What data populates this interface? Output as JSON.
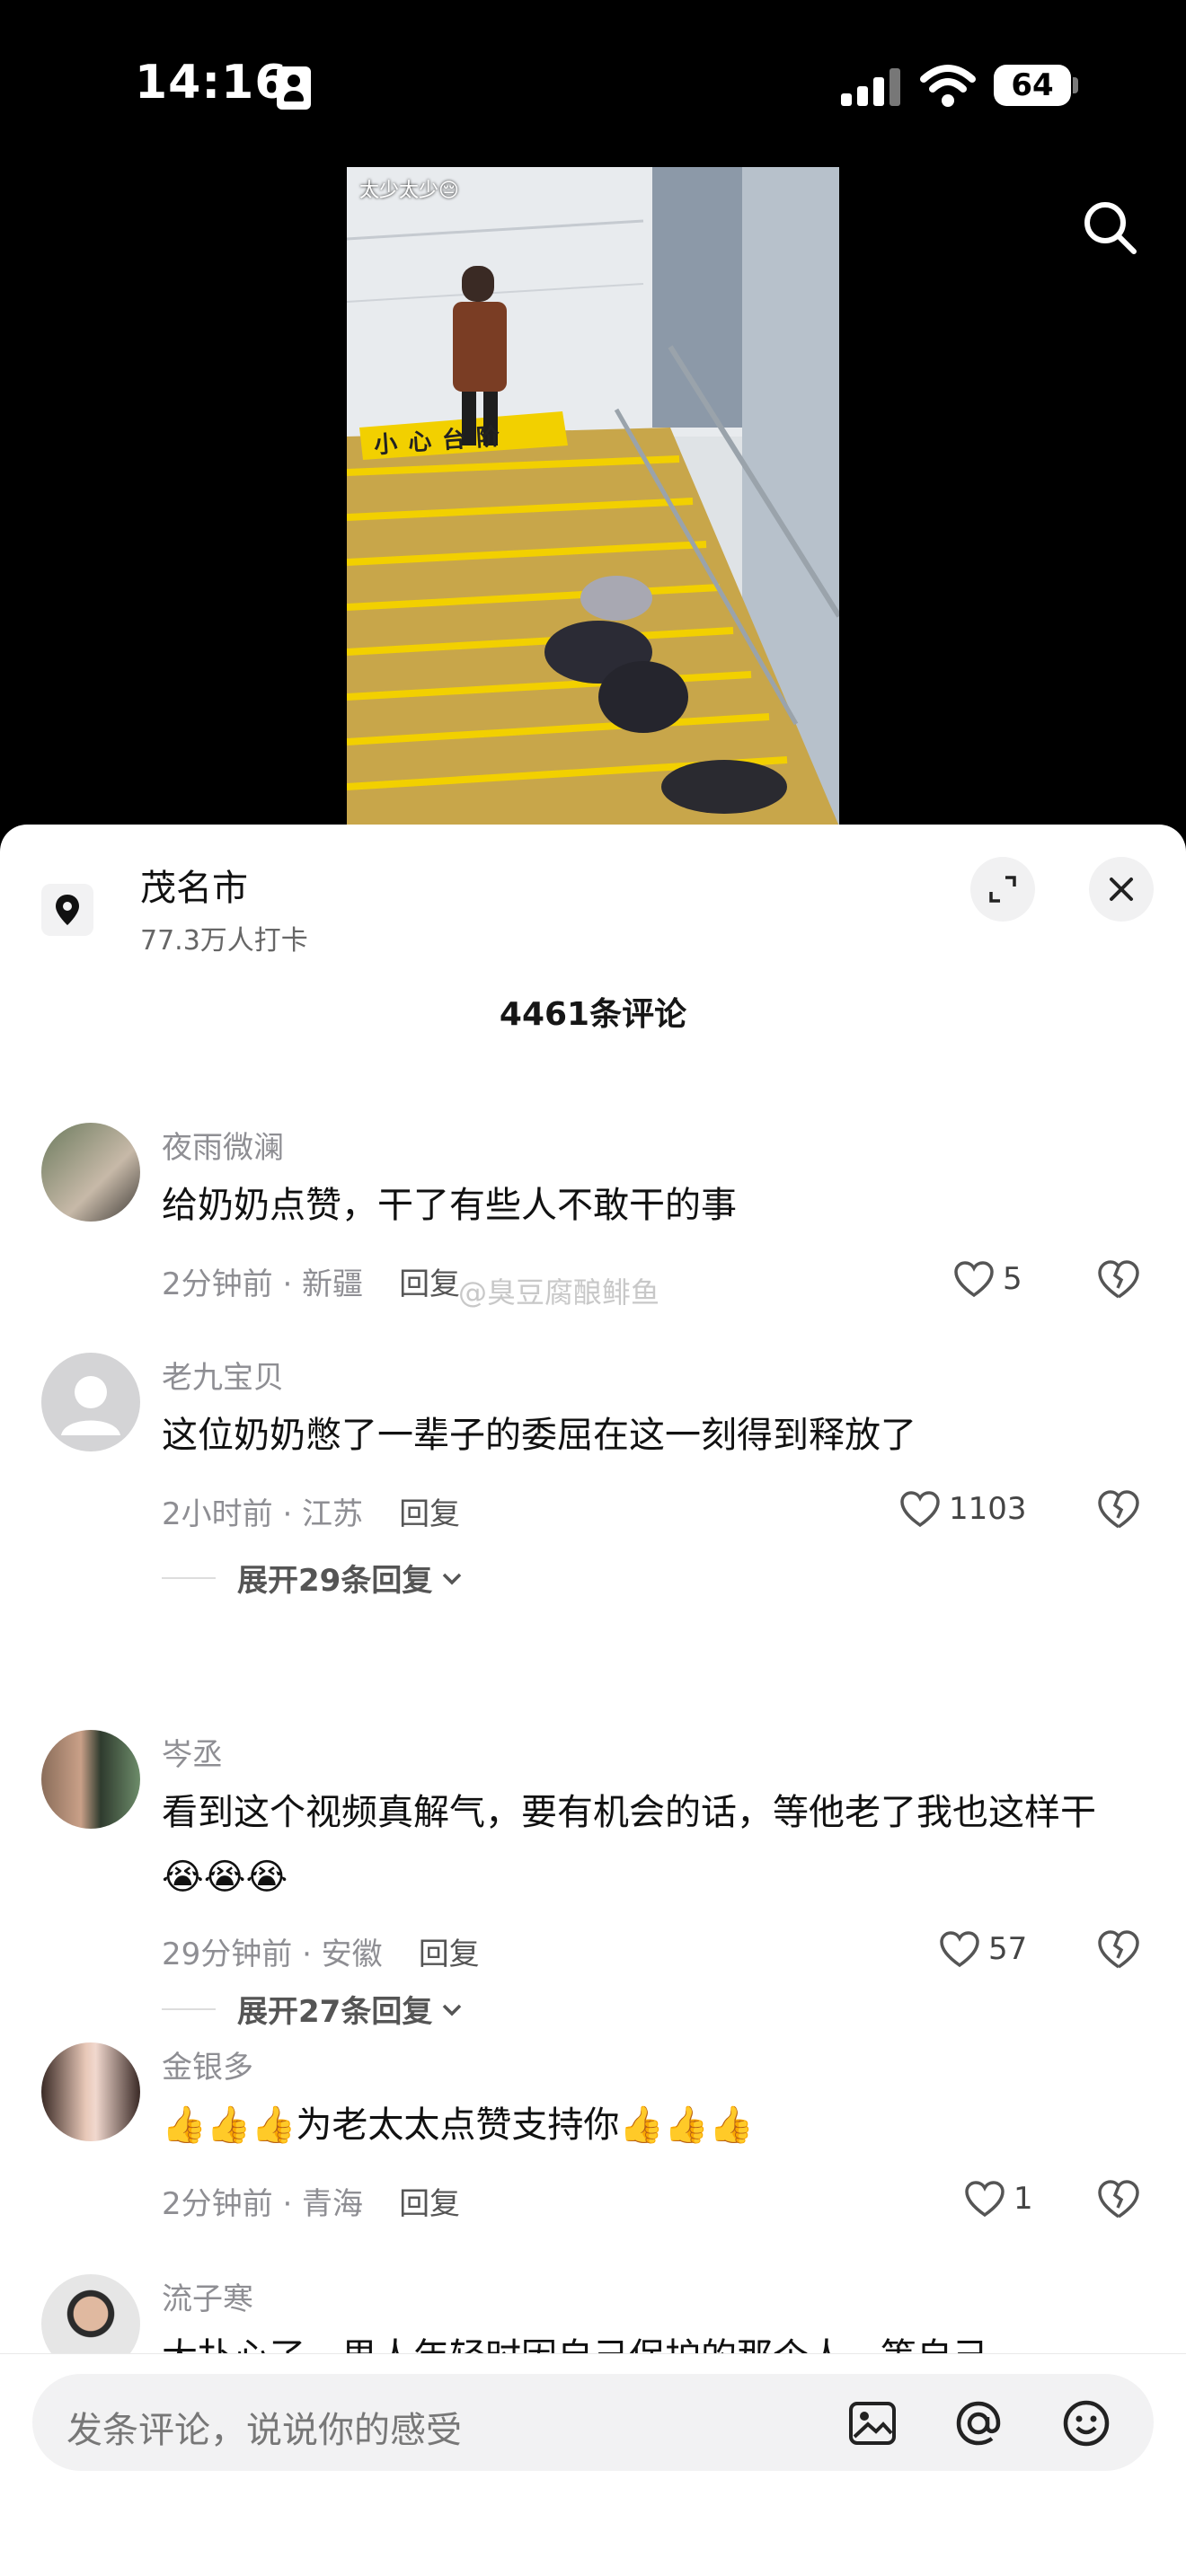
{
  "status_bar": {
    "time": "14:16",
    "battery": "64"
  },
  "video": {
    "caption": "太少太少😔",
    "sign_text": "小心台阶"
  },
  "location": {
    "name": "茂名市",
    "checkins": "77.3万人打卡"
  },
  "comments_header": {
    "count": "4461条评论"
  },
  "comments": [
    {
      "user": "夜雨微澜",
      "text": "给奶奶点赞，干了有些人不敢干的事",
      "meta": "2分钟前 · 新疆",
      "reply": "回复",
      "likes": "5"
    },
    {
      "user": "老九宝贝",
      "text": "这位奶奶憋了一辈子的委屈在这一刻得到释放了",
      "meta": "2小时前 · 江苏",
      "reply": "回复",
      "likes": "1103",
      "expand": "展开29条回复"
    },
    {
      "user": "岑丞",
      "text": "看到这个视频真解气，要有机会的话，等他老了我也这样干😭😭😭",
      "meta": "29分钟前 · 安徽",
      "reply": "回复",
      "likes": "57",
      "expand": "展开27条回复"
    },
    {
      "user": "金银多",
      "text": "👍👍👍为老太太点赞支持你👍👍👍",
      "meta": "2分钟前 · 青海",
      "reply": "回复",
      "likes": "1"
    },
    {
      "user": "流子寒",
      "text": "大扑心了，男人年轻时因自己保护的那个人，等自己"
    }
  ],
  "watermark": "@臭豆腐酿鲱鱼",
  "input": {
    "placeholder": "发条评论，说说你的感受"
  },
  "colors": {
    "sign_yellow": "#f2d000",
    "heart_gray": "#555555"
  }
}
